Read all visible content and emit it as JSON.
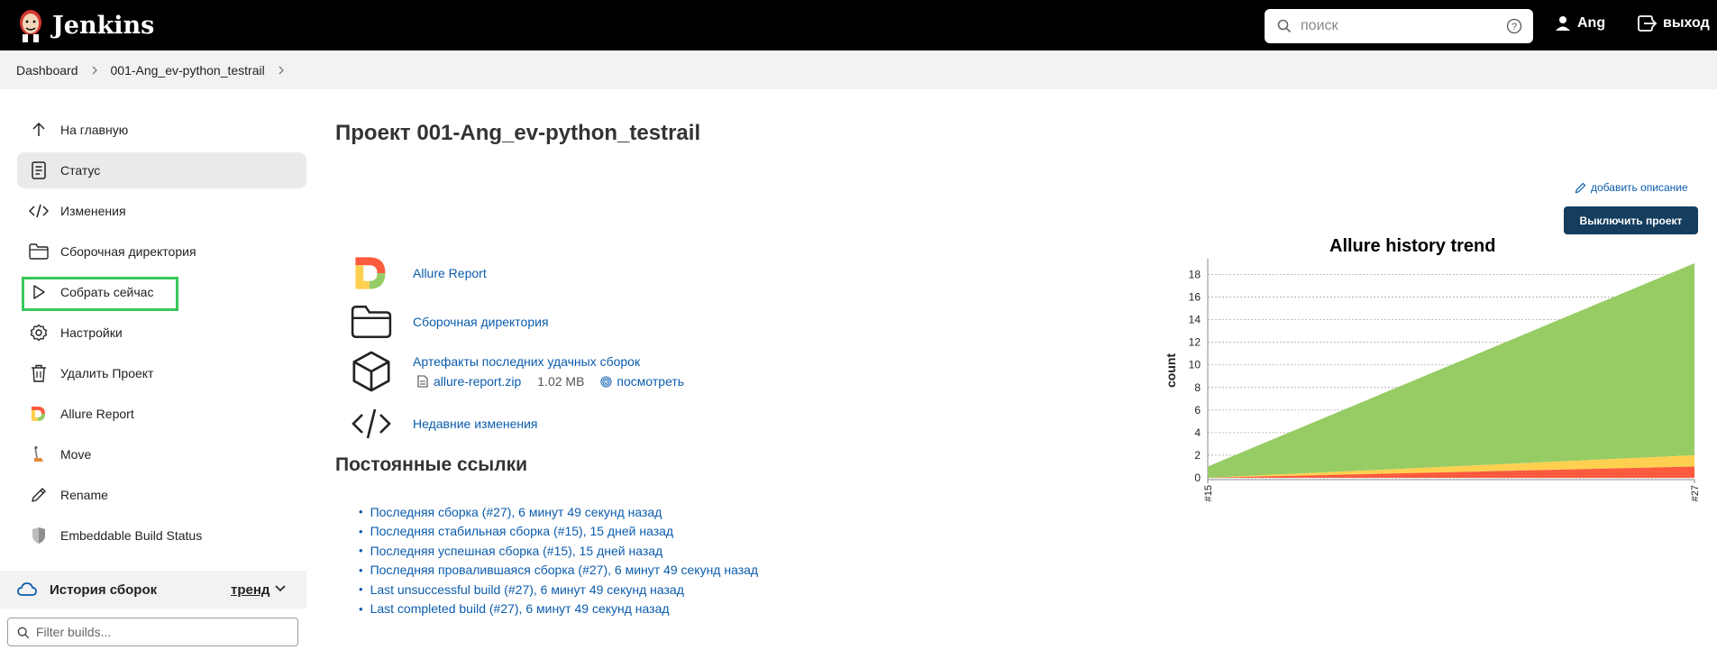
{
  "app": {
    "title": "Jenkins"
  },
  "header": {
    "search_placeholder": "поиск",
    "user": "Ang",
    "logout": "выход"
  },
  "breadcrumb": {
    "items": [
      "Dashboard",
      "001-Ang_ev-python_testrail"
    ]
  },
  "sidebar": {
    "items": [
      {
        "label": "На главную",
        "icon": "arrow-up-icon"
      },
      {
        "label": "Статус",
        "icon": "document-icon"
      },
      {
        "label": "Изменения",
        "icon": "code-icon"
      },
      {
        "label": "Сборочная директория",
        "icon": "folder-icon"
      },
      {
        "label": "Собрать сейчас",
        "icon": "play-icon"
      },
      {
        "label": "Настройки",
        "icon": "gear-icon"
      },
      {
        "label": "Удалить Проект",
        "icon": "trash-icon"
      },
      {
        "label": "Allure Report",
        "icon": "allure-icon"
      },
      {
        "label": "Move",
        "icon": "move-icon"
      },
      {
        "label": "Rename",
        "icon": "pencil-icon"
      },
      {
        "label": "Embeddable Build Status",
        "icon": "badge-icon"
      }
    ],
    "history": {
      "label": "История сборок",
      "trend": "тренд"
    },
    "filter_placeholder": "Filter builds..."
  },
  "main": {
    "title": "Проект 001-Ang_ev-python_testrail",
    "add_description": "добавить описание",
    "disable_button": "Выключить проект",
    "links": {
      "allure": "Allure Report",
      "workspace": "Сборочная директория",
      "artifacts": "Артефакты последних удачных сборок",
      "artifact_file": "allure-report.zip",
      "artifact_size": "1.02 MB",
      "artifact_view": "посмотреть",
      "changes": "Недавние изменения"
    },
    "permalinks_title": "Постоянные ссылки",
    "permalinks": [
      "Последняя сборка (#27), 6 минут 49 секунд назад",
      "Последняя стабильная сборка (#15), 15 дней назад",
      "Последняя успешная сборка (#15), 15 дней назад",
      "Последняя провалившаяся сборка (#27), 6 минут 49 секунд назад",
      "Last unsuccessful build (#27), 6 минут 49 секунд назад",
      "Last completed build (#27), 6 минут 49 секунд назад"
    ]
  },
  "colors": {
    "header_bg": "#000000",
    "link": "#0b5cad",
    "button_bg": "#143d5e",
    "passed": "#97cc64",
    "broken": "#ffd050",
    "failed": "#fd5a3e"
  },
  "chart_data": {
    "type": "area",
    "title": "Allure history trend",
    "ylabel": "count",
    "xlabel": "",
    "x": [
      "#15",
      "#27"
    ],
    "ylim": [
      0,
      19
    ],
    "yticks": [
      0,
      2,
      4,
      6,
      8,
      10,
      12,
      14,
      16,
      18
    ],
    "grid": true,
    "stacked": true,
    "series": [
      {
        "values": [
          0,
          1
        ],
        "color": "#fd5a3e"
      },
      {
        "values": [
          0,
          1
        ],
        "color": "#ffd050"
      },
      {
        "values": [
          1,
          17
        ],
        "color": "#97cc64"
      }
    ]
  }
}
